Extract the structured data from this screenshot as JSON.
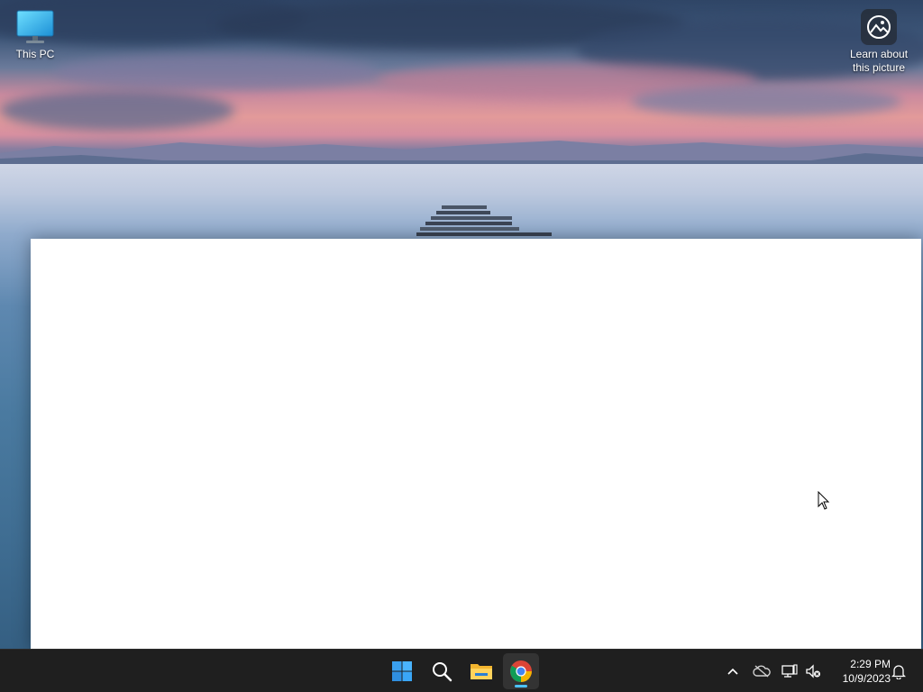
{
  "desktop": {
    "icons": [
      {
        "label": "This PC",
        "icon": "monitor-icon"
      },
      {
        "label": "Learn about this picture",
        "icon": "spotlight-icon"
      }
    ]
  },
  "taskbar": {
    "pinned": [
      {
        "name": "Start",
        "icon": "windows-logo-icon"
      },
      {
        "name": "Search",
        "icon": "search-icon"
      },
      {
        "name": "File Explorer",
        "icon": "folder-icon"
      },
      {
        "name": "Google Chrome",
        "icon": "chrome-icon",
        "active": true
      }
    ],
    "tray": {
      "icons": [
        "chevron-up-icon",
        "onedrive-offline-icon",
        "network-icon",
        "volume-muted-icon",
        "notification-bell-icon"
      ],
      "time": "2:29 PM",
      "date": "10/9/2023"
    }
  },
  "colors": {
    "taskbar_bg": "#1f1f1f",
    "accent": "#4cc2ff",
    "window_bg": "#ffffff"
  }
}
